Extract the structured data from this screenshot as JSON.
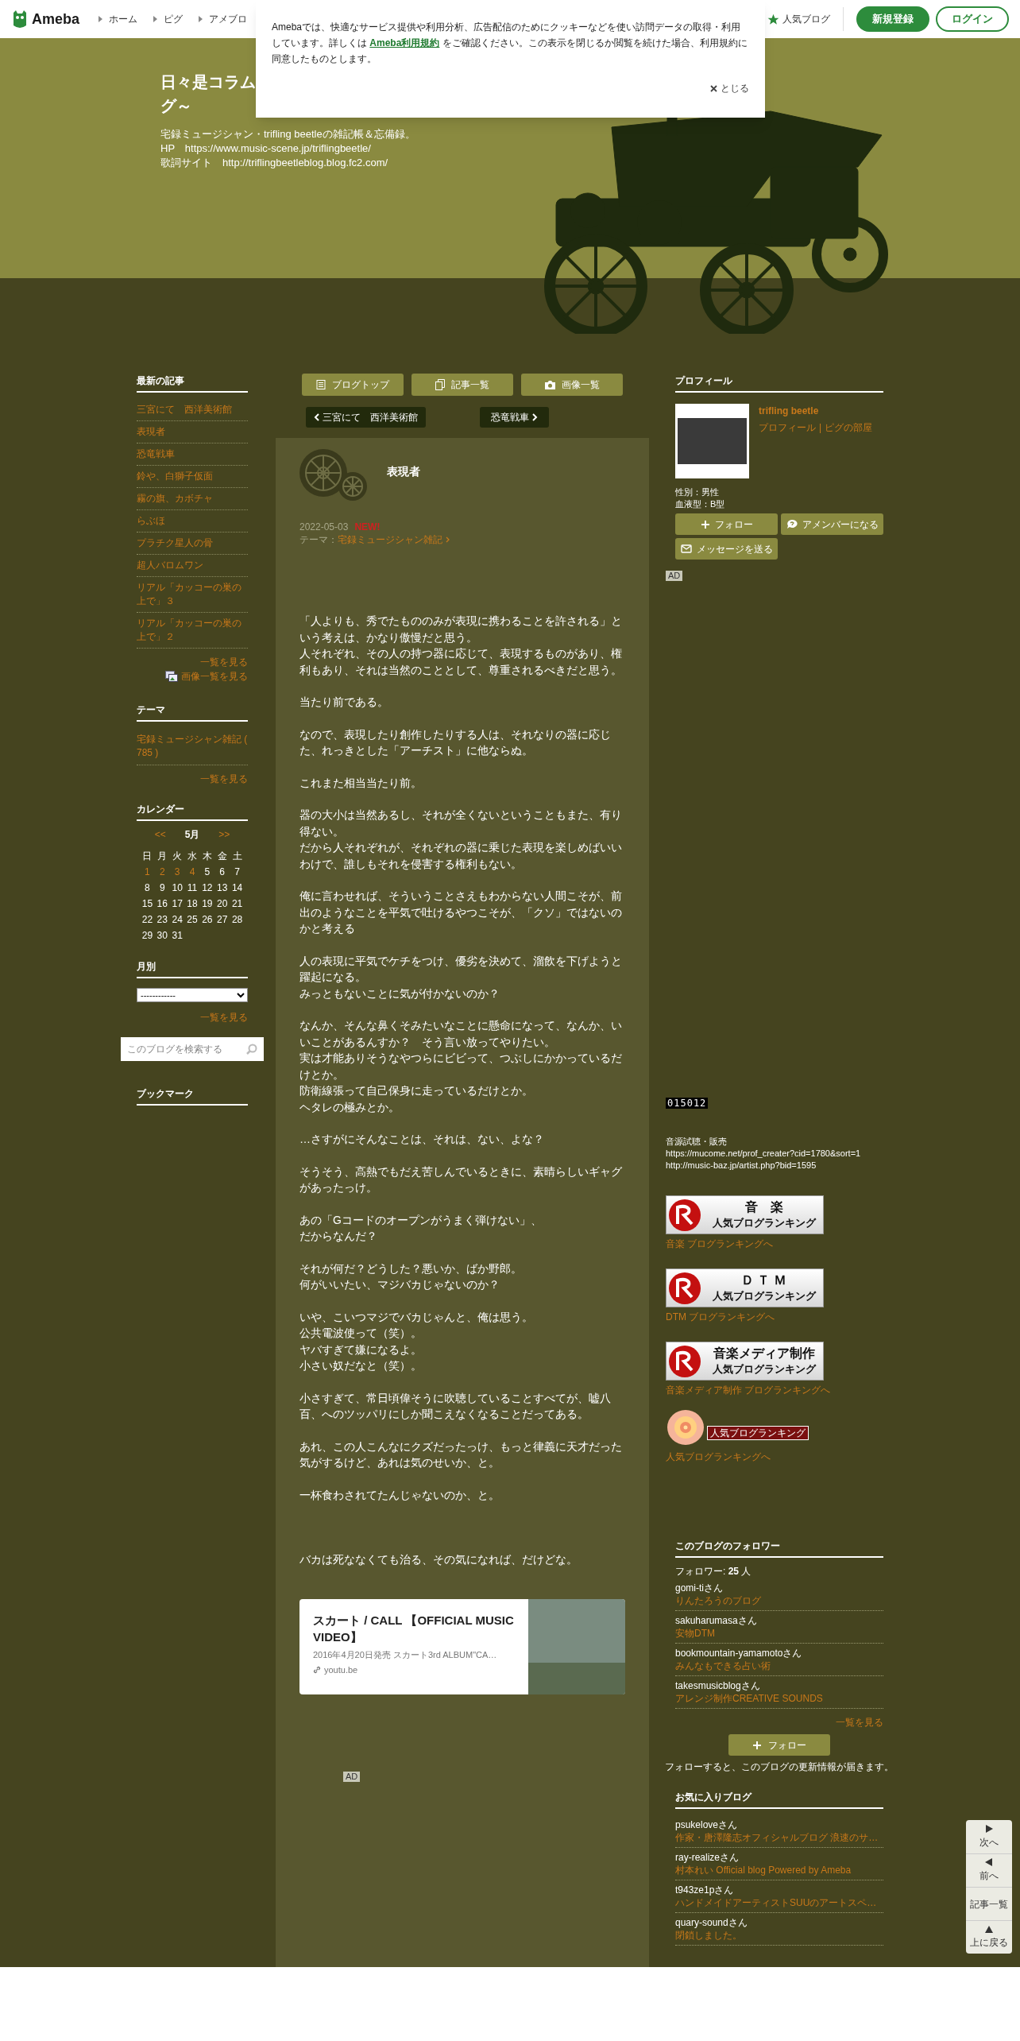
{
  "header": {
    "logo": "Ameba",
    "nav": [
      "ホーム",
      "ピグ",
      "アメブロ"
    ],
    "popular": "人気ブログ",
    "signup": "新規登録",
    "login": "ログイン"
  },
  "cookie_banner": {
    "text_before": "Amebaでは、快適なサービス提供や利用分析、広告配信のためにクッキーなどを使い訪問データの取得・利用しています。詳しくは ",
    "link": "Ameba利用規約",
    "text_after": " をご確認ください。この表示を閉じるか閲覧を続けた場合、利用規約に同意したものとします。",
    "close": "とじる"
  },
  "blog": {
    "title_lines": [
      "日々是コラム",
      "グ～"
    ],
    "description": [
      "宅録ミュージシャン・trifling beetleの雑記帳＆忘備録。",
      "HP　https://www.music-scene.jp/triflingbeetle/",
      "歌詞サイト　http://triflingbeetleblog.blog.fc2.com/"
    ]
  },
  "left_sidebar": {
    "recent": {
      "heading": "最新の記事",
      "items": [
        "三宮にて　西洋美術館",
        "表現者",
        "恐竜戦車",
        "鈴や、白獅子仮面",
        "霧の旗、カボチャ",
        "らぶほ",
        "プラチク星人の骨",
        "超人バロムワン",
        "リアル「カッコーの巣の上で」３",
        "リアル「カッコーの巣の上で」２"
      ],
      "more": "一覧を見る",
      "image_more": "画像一覧を見る"
    },
    "theme": {
      "heading": "テーマ",
      "items": [
        "宅録ミュージシャン雑記 ( 785 )"
      ],
      "more": "一覧を見る"
    },
    "calendar": {
      "heading": "カレンダー",
      "prev": "<<",
      "month": "5月",
      "next": ">>",
      "weekdays": [
        "日",
        "月",
        "火",
        "水",
        "木",
        "金",
        "土"
      ],
      "weeks": [
        [
          {
            "day": "1",
            "linked": true
          },
          {
            "day": "2",
            "linked": true
          },
          {
            "day": "3",
            "linked": true
          },
          {
            "day": "4",
            "linked": true
          },
          {
            "day": "5",
            "linked": false
          },
          {
            "day": "6",
            "linked": false
          },
          {
            "day": "7",
            "linked": false
          }
        ],
        [
          {
            "day": "8",
            "linked": false
          },
          {
            "day": "9",
            "linked": false
          },
          {
            "day": "10",
            "linked": false
          },
          {
            "day": "11",
            "linked": false
          },
          {
            "day": "12",
            "linked": false
          },
          {
            "day": "13",
            "linked": false
          },
          {
            "day": "14",
            "linked": false
          }
        ],
        [
          {
            "day": "15",
            "linked": false
          },
          {
            "day": "16",
            "linked": false
          },
          {
            "day": "17",
            "linked": false
          },
          {
            "day": "18",
            "linked": false
          },
          {
            "day": "19",
            "linked": false
          },
          {
            "day": "20",
            "linked": false
          },
          {
            "day": "21",
            "linked": false
          }
        ],
        [
          {
            "day": "22",
            "linked": false
          },
          {
            "day": "23",
            "linked": false
          },
          {
            "day": "24",
            "linked": false
          },
          {
            "day": "25",
            "linked": false
          },
          {
            "day": "26",
            "linked": false
          },
          {
            "day": "27",
            "linked": false
          },
          {
            "day": "28",
            "linked": false
          }
        ],
        [
          {
            "day": "29",
            "linked": false
          },
          {
            "day": "30",
            "linked": false
          },
          {
            "day": "31",
            "linked": false
          }
        ]
      ]
    },
    "monthly": {
      "heading": "月別",
      "select": "------------",
      "more": "一覧を見る"
    },
    "search": {
      "placeholder": "このブログを検索する"
    },
    "bookmark": {
      "heading": "ブックマーク"
    }
  },
  "article": {
    "nav_buttons": [
      {
        "label": "ブログトップ",
        "kind": "top"
      },
      {
        "label": "記事一覧",
        "kind": "list"
      },
      {
        "label": "画像一覧",
        "kind": "image"
      }
    ],
    "prev": "三宮にて　西洋美術館",
    "next": "恐竜戦車",
    "title": "表現者",
    "date": "2022-05-03",
    "new_badge": "NEW!",
    "theme_label": "テーマ：",
    "theme": "宅録ミュージシャン雑記",
    "paragraphs": [
      [
        "「人よりも、秀でたもののみが表現に携わることを許される」という考えは、かなり傲慢だと思う。",
        "人それぞれ、その人の持つ器に応じて、表現するものがあり、権利もあり、それは当然のこととして、尊重されるべきだと思う。"
      ],
      [
        "当たり前である。"
      ],
      [
        "なので、表現したり創作したりする人は、それなりの器に応じた、れっきとした「アーチスト」に他ならぬ。"
      ],
      [
        "これまた相当当たり前。"
      ],
      [
        "器の大小は当然あるし、それが全くないということもまた、有り得ない。",
        "だから人それぞれが、それぞれの器に乗じた表現を楽しめばいいわけで、誰しもそれを侵害する権利もない。"
      ],
      [
        "俺に言わせれば、そういうことさえもわからない人間こそが、前出のようなことを平気で吐けるやつこそが、「クソ」ではないのかと考える"
      ],
      [
        "人の表現に平気でケチをつけ、優劣を決めて、溜飲を下げようと躍起になる。",
        "みっともないことに気が付かないのか？"
      ],
      [
        "なんか、そんな鼻くそみたいなことに懸命になって、なんか、いいことがあるんすか？　そう言い放ってやりたい。",
        "実は才能ありそうなやつらにビビって、つぶしにかかっているだけとか。",
        "防衛線張って自己保身に走っているだけとか。",
        "ヘタレの極みとか。"
      ],
      [
        "…さすがにそんなことは、それは、ない、よな？"
      ],
      [
        "そうそう、高熱でもだえ苦しんでいるときに、素晴らしいギャグがあったっけ。"
      ],
      [
        "あの「Gコードのオープンがうまく弾けない」、",
        "だからなんだ？"
      ],
      [
        "それが何だ？どうした？悪いか、ばか野郎。",
        "何がいいたい、マジバカじゃないのか？"
      ],
      [
        "いや、こいつマジでバカじゃんと、俺は思う。",
        "公共電波使って（笑）。",
        "ヤバすぎて嫌になるよ。",
        "小さい奴だなと（笑）。"
      ],
      [
        "小さすぎて、常日頃偉そうに吹聴していることすべてが、嘘八百、へのツッパリにしか聞こえなくなることだってある。"
      ],
      [
        "あれ、この人こんなにクズだったっけ、もっと律義に天才だった気がするけど、あれは気のせいか、と。"
      ],
      [
        "一杯食わされてたんじゃないのか、と。"
      ]
    ],
    "closing": "バカは死ななくても治る、その気になれば、だけどな。",
    "link_card": {
      "title": "スカート / CALL 【OFFICIAL MUSIC VIDEO】",
      "description": "2016年4月20日発売 スカート3rd ALBUM\"CA…",
      "domain": "youtu.be"
    },
    "ad": "AD"
  },
  "right_sidebar": {
    "profile": {
      "heading": "プロフィール",
      "name": "trifling beetle",
      "links": [
        "プロフィール",
        "ピグの部屋"
      ],
      "link_separator": "|",
      "details": [
        "性別：男性",
        "血液型：B型"
      ],
      "buttons": [
        {
          "label": "フォロー",
          "kind": "follow"
        },
        {
          "label": "アメンバーになる",
          "kind": "amember"
        },
        {
          "label": "メッセージを送る",
          "kind": "message"
        }
      ]
    },
    "ad": "AD",
    "counter": "015012",
    "free_text": [
      "音源試聴・販売",
      "https://mucome.net/prof_creater?cid=1780&sort=1",
      "http://music-baz.jp/artist.php?bid=1595"
    ],
    "rankings": [
      {
        "banner_title": "音　楽",
        "banner_sub": "人気ブログランキング",
        "link": "音楽 ブログランキングへ"
      },
      {
        "banner_title": "Ｄ Ｔ Ｍ",
        "banner_sub": "人気ブログランキング",
        "link": "DTM ブログランキングへ"
      },
      {
        "banner_title": "音楽メディア制作",
        "banner_sub": "人気ブログランキング",
        "link": "音楽メディア制作 ブログランキングへ"
      }
    ],
    "roll_ranking": {
      "badge": "人気ブログランキング",
      "link": "人気ブログランキングへ"
    },
    "followers": {
      "heading": "このブログのフォロワー",
      "count": "フォロワー: **25** 人",
      "items": [
        {
          "user": "gomi-tiさん",
          "blog": "りんたろうのブログ"
        },
        {
          "user": "sakuharumasaさん",
          "blog": "安物DTM"
        },
        {
          "user": "bookmountain-yamamotoさん",
          "blog": "みんなもできる占い術"
        },
        {
          "user": "takesmusicblogさん",
          "blog": "アレンジ制作CREATIVE SOUNDS"
        }
      ],
      "more": "一覧を見る",
      "follow": "フォロー",
      "note": "フォローすると、このブログの更新情報が届きます。"
    },
    "favorites": {
      "heading": "お気に入りブログ",
      "items": [
        {
          "user": "psukeloveさん",
          "blog": "作家・唐澤隆志オフィシャルブログ 浪速のサ…"
        },
        {
          "user": "ray-realizeさん",
          "blog": "村本れい Official blog Powered by Ameba"
        },
        {
          "user": "t943ze1pさん",
          "blog": "ハンドメイドアーティストSUUのアートスペ…"
        },
        {
          "user": "quary-soundさん",
          "blog": "閉鎖しました。"
        }
      ]
    }
  },
  "scroll_nav": [
    {
      "label": "次へ",
      "kind": "next"
    },
    {
      "label": "前へ",
      "kind": "prev"
    },
    {
      "label": "記事一覧",
      "kind": "list"
    },
    {
      "label": "上に戻る",
      "kind": "top"
    }
  ]
}
